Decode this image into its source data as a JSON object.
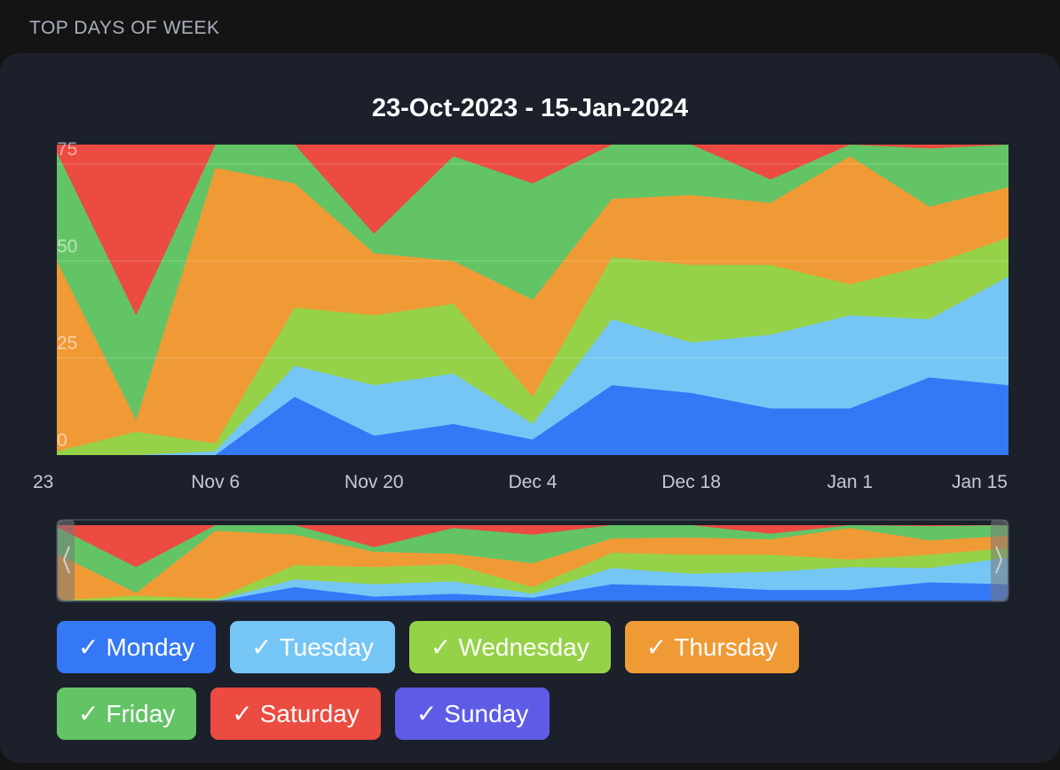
{
  "section_title": "TOP DAYS OF WEEK",
  "chart_data": {
    "type": "area",
    "stacked": true,
    "title": "23-Oct-2023 - 15-Jan-2024",
    "x": [
      "2023-10-23",
      "2023-10-30",
      "2023-11-06",
      "2023-11-13",
      "2023-11-20",
      "2023-11-27",
      "2023-12-04",
      "2023-12-11",
      "2023-12-18",
      "2023-12-25",
      "2024-01-01",
      "2024-01-08",
      "2024-01-15"
    ],
    "x_tick_labels": [
      "23",
      "Nov 6",
      "Nov 20",
      "Dec 4",
      "Dec 18",
      "Jan 1",
      "Jan 15"
    ],
    "ylim": [
      0,
      80
    ],
    "y_ticks": [
      0,
      25,
      50,
      75
    ],
    "grid": true,
    "series": [
      {
        "name": "Monday",
        "color": "#3478f6",
        "values": [
          0,
          0,
          0,
          15,
          5,
          8,
          4,
          18,
          16,
          12,
          12,
          20,
          18
        ]
      },
      {
        "name": "Tuesday",
        "color": "#75c6f5",
        "values": [
          0,
          0,
          1,
          8,
          13,
          13,
          4,
          17,
          13,
          19,
          24,
          15,
          28
        ]
      },
      {
        "name": "Wednesday",
        "color": "#95d247",
        "values": [
          1,
          6,
          2,
          15,
          18,
          18,
          7,
          16,
          20,
          18,
          8,
          14,
          10
        ]
      },
      {
        "name": "Thursday",
        "color": "#f09a36",
        "values": [
          49,
          3,
          71,
          32,
          16,
          11,
          25,
          15,
          18,
          16,
          33,
          15,
          13
        ]
      },
      {
        "name": "Friday",
        "color": "#63c465",
        "values": [
          28,
          27,
          14,
          25,
          5,
          27,
          30,
          33,
          25,
          6,
          8,
          15,
          14
        ]
      },
      {
        "name": "Saturday",
        "color": "#eb4b40",
        "values": [
          16,
          52,
          7,
          7,
          34,
          13,
          17,
          11,
          24,
          28,
          11,
          12,
          12
        ]
      }
    ],
    "remainder_series": {
      "name": "Sunday",
      "color": "#5e5ce6"
    }
  },
  "navigator": {
    "left_handle_icon": "chevron-left-icon",
    "right_handle_icon": "chevron-right-icon"
  },
  "legend": {
    "check_glyph": "✓",
    "items": [
      {
        "label": "Monday",
        "color": "#3478f6"
      },
      {
        "label": "Tuesday",
        "color": "#75c6f5"
      },
      {
        "label": "Wednesday",
        "color": "#95d247"
      },
      {
        "label": "Thursday",
        "color": "#f09a36"
      },
      {
        "label": "Friday",
        "color": "#63c465"
      },
      {
        "label": "Saturday",
        "color": "#eb4b40"
      },
      {
        "label": "Sunday",
        "color": "#5e5ce6"
      }
    ]
  }
}
